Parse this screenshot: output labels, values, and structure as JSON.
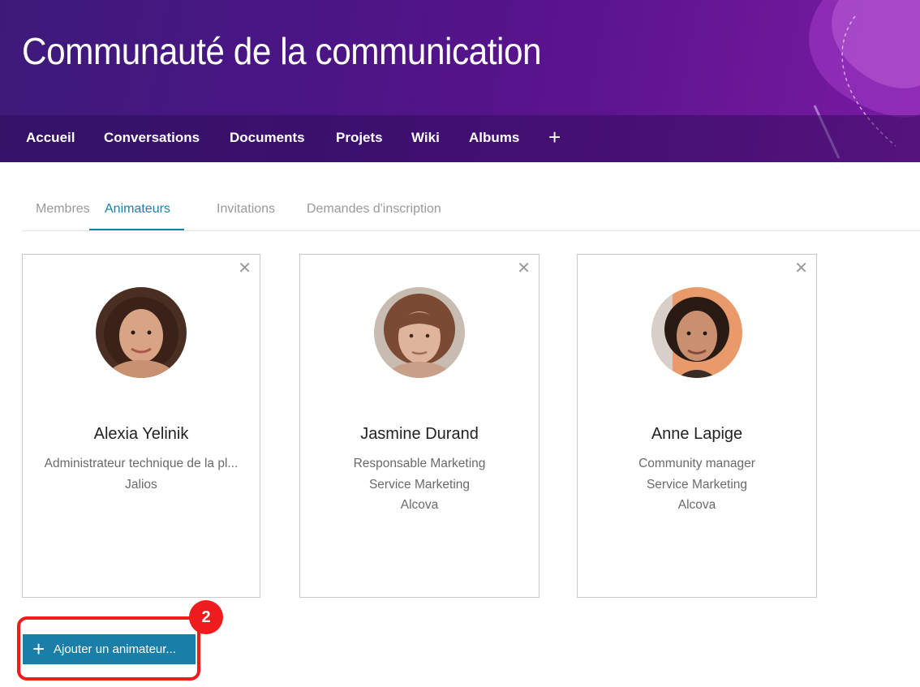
{
  "header": {
    "title": "Communauté de la communication"
  },
  "nav": {
    "items": [
      "Accueil",
      "Conversations",
      "Documents",
      "Projets",
      "Wiki",
      "Albums"
    ],
    "plus": "+"
  },
  "tabs": {
    "items": [
      "Membres",
      "Animateurs",
      "Invitations",
      "Demandes d'inscription"
    ],
    "active": "Animateurs"
  },
  "cards": [
    {
      "name": "Alexia Yelinik",
      "lines": [
        "Administrateur technique de la pl...",
        "Jalios"
      ],
      "close": "✕"
    },
    {
      "name": "Jasmine Durand",
      "lines": [
        "Responsable Marketing",
        "Service Marketing",
        "Alcova"
      ],
      "close": "✕"
    },
    {
      "name": "Anne Lapige",
      "lines": [
        "Community manager",
        "Service Marketing",
        "Alcova"
      ],
      "close": "✕"
    }
  ],
  "add_button": {
    "icon": "+",
    "label": "Ajouter un animateur..."
  },
  "annotation": {
    "badge": "2",
    "color": "#ee1c1c"
  },
  "colors": {
    "accent": "#1a7fa8",
    "banner": "#4b1585"
  }
}
